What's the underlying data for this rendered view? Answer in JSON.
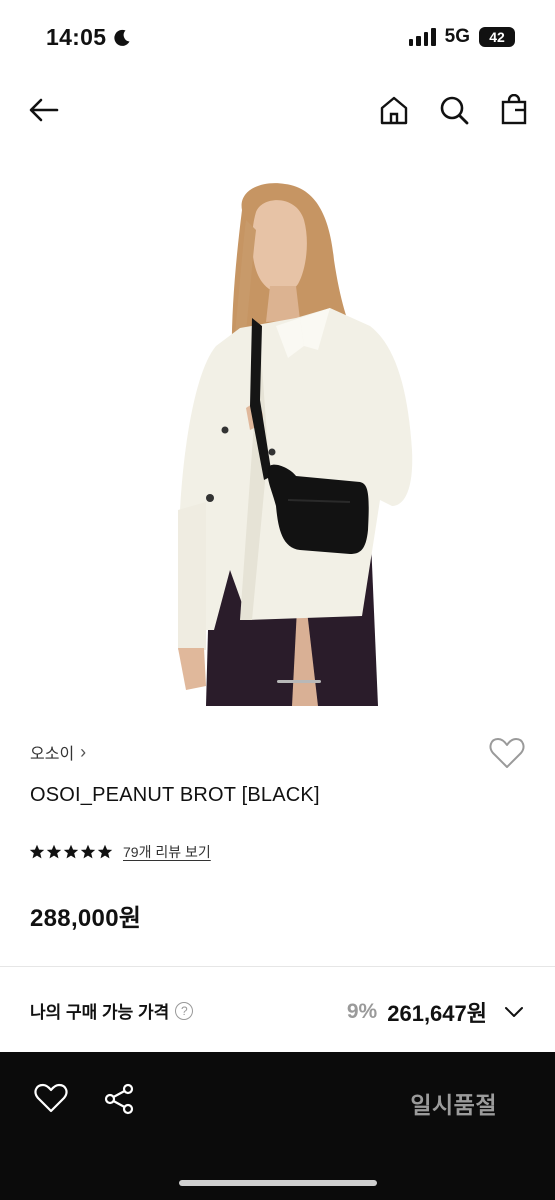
{
  "status_bar": {
    "time": "14:05",
    "network": "5G",
    "battery": "42",
    "battery_level": 0.42
  },
  "nav": {
    "back_icon": "arrow-left-icon",
    "home_icon": "home-icon",
    "search_icon": "search-icon",
    "bag_icon": "shopping-bag-icon"
  },
  "gallery": {
    "image_description_icon": "product-photo"
  },
  "product": {
    "brand": "오소이",
    "brand_chevron": "›",
    "name": "OSOI_PEANUT BROT [BLACK]",
    "rating_stars": 5,
    "review_link": "79개 리뷰 보기",
    "price": "288,000원"
  },
  "my_price": {
    "label": "나의 구매 가능 가격",
    "help": "?",
    "discount": "9%",
    "value": "261,647원"
  },
  "bottom_bar": {
    "wish_icon": "heart-icon",
    "share_icon": "share-icon",
    "status_label": "일시품절"
  },
  "colors": {
    "accent": "#0b0b0b",
    "muted": "#9b9b9b"
  }
}
